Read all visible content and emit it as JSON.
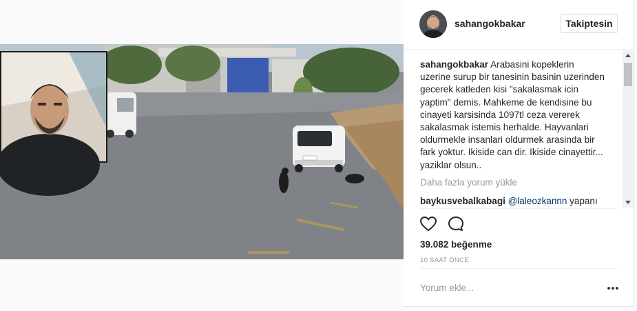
{
  "post": {
    "username": "sahangokbakar",
    "follow_label": "Takiptesin",
    "caption_user": "sahangokbakar",
    "caption_text": "Arabasini kopeklerin uzerine surup bir tanesinin basinin uzerinden gecerek katleden kisi \"sakalasmak icin yaptim\" demis. Mahkeme de kendisine bu cinayeti karsisinda 1097tl ceza vererek sakalasmak istemis herhalde. Hayvanlari oldurmekle insanlari oldurmek arasinda bir fark yoktur. Ikiside can dir. Ikiside cinayettir... yaziklar olsun..",
    "load_more": "Daha fazla yorum yükle",
    "comment": {
      "user": "baykusvebalkabagi",
      "mention": "@laleozkannn",
      "text": "yapanı"
    },
    "likes": "39.082 beğenme",
    "time": "10 SAAT ÖNCE",
    "add_comment_placeholder": "Yorum ekle..."
  },
  "icons": {
    "like": "heart-icon",
    "comment": "comment-bubble-icon",
    "more": "more-options-icon"
  },
  "colors": {
    "text": "#262626",
    "muted": "#999999",
    "link": "#003569",
    "border": "#dbdbdb"
  }
}
